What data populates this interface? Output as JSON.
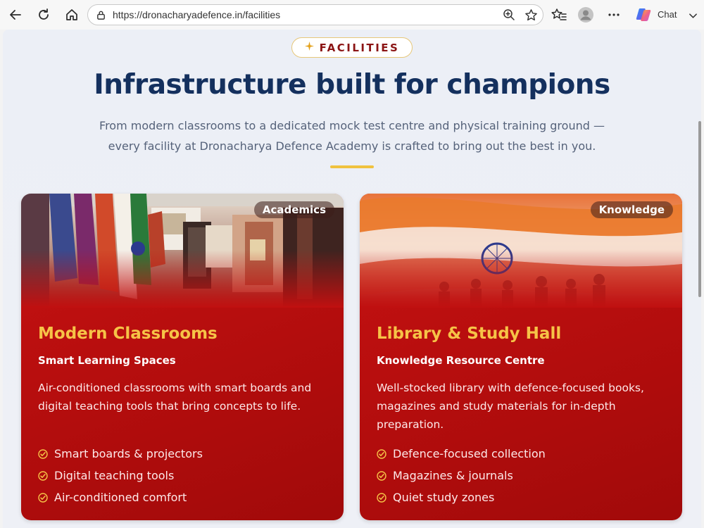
{
  "browser": {
    "url": "https://dronacharyadefence.in/facilities",
    "chat_label": "Chat",
    "icons": [
      "back-arrow-icon",
      "refresh-icon",
      "home-icon",
      "site-info-icon",
      "zoom-icon",
      "favorite-star-icon",
      "favorites-list-icon",
      "profile-avatar-icon",
      "more-menu-icon",
      "copilot-icon",
      "chevron-down-icon"
    ]
  },
  "section": {
    "pill_label": "FACILITIES",
    "title": "Infrastructure built for champions",
    "subtitle": "From modern classrooms to a dedicated mock test centre and physical training ground — every facility at Dronacharya Defence Academy is crafted to bring out the best in you."
  },
  "cards": [
    {
      "badge": "Academics",
      "title": "Modern Classrooms",
      "subtitle": "Smart Learning Spaces",
      "description": "Air-conditioned classrooms with smart boards and digital teaching tools that bring concepts to life.",
      "features": [
        "Smart boards & projectors",
        "Digital teaching tools",
        "Air-conditioned comfort"
      ]
    },
    {
      "badge": "Knowledge",
      "title": "Library & Study Hall",
      "subtitle": "Knowledge Resource Centre",
      "description": "Well-stocked library with defence-focused books, magazines and study materials for in-depth preparation.",
      "features": [
        "Defence-focused collection",
        "Magazines & journals",
        "Quiet study zones"
      ]
    }
  ],
  "colors": {
    "title": "#14305e",
    "card_red": "#b30d0d",
    "card_title": "#f6c347",
    "accent_gold": "#f0c23e"
  }
}
